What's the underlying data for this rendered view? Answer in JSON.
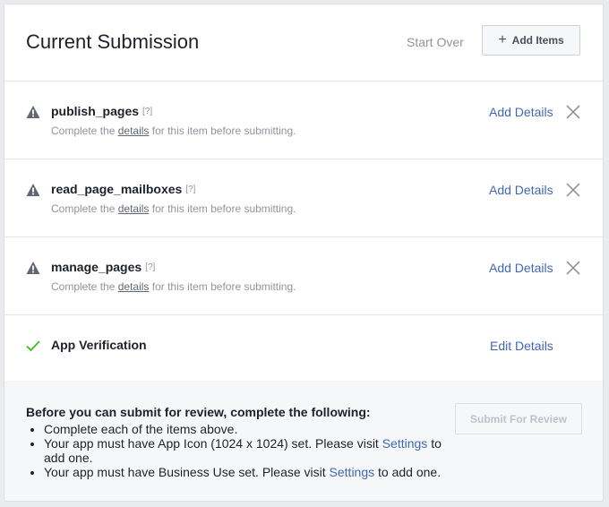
{
  "header": {
    "title": "Current Submission",
    "start_over": "Start Over",
    "add_items": "Add Items"
  },
  "items": [
    {
      "name": "publish_pages",
      "help": "[?]",
      "desc_before": "Complete the",
      "desc_link": "details",
      "desc_after": "for this item before submitting.",
      "action": "Add Details",
      "status": "warning"
    },
    {
      "name": "read_page_mailboxes",
      "help": "[?]",
      "desc_before": "Complete the",
      "desc_link": "details",
      "desc_after": "for this item before submitting.",
      "action": "Add Details",
      "status": "warning"
    },
    {
      "name": "manage_pages",
      "help": "[?]",
      "desc_before": "Complete the",
      "desc_link": "details",
      "desc_after": "for this item before submitting.",
      "action": "Add Details",
      "status": "warning"
    }
  ],
  "verification": {
    "name": "App Verification",
    "action": "Edit Details",
    "status": "complete"
  },
  "footer": {
    "title": "Before you can submit for review, complete the following:",
    "bullets": [
      {
        "text": "Complete each of the items above."
      },
      {
        "before": "Your app must have App Icon (1024 x 1024) set. Please visit",
        "link": "Settings",
        "after": "to add one."
      },
      {
        "before": "Your app must have Business Use set. Please visit",
        "link": "Settings",
        "after": "to add one."
      }
    ],
    "submit": "Submit For Review"
  },
  "colors": {
    "link": "#4267b2",
    "warning_icon": "#606770",
    "check_icon": "#42b72a"
  }
}
